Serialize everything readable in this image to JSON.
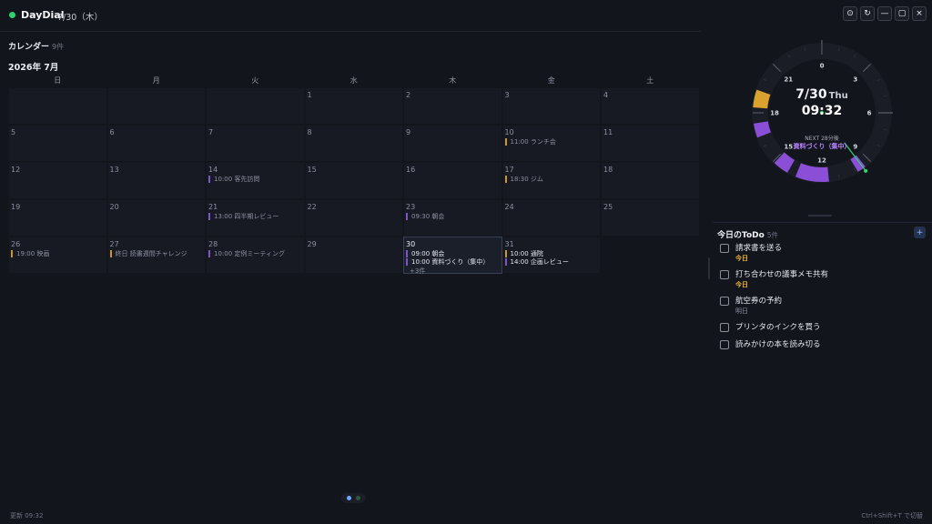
{
  "app": {
    "name": "DayDial",
    "date": "7/30（木）"
  },
  "window_buttons": [
    "⊙",
    "↻",
    "—",
    "▢",
    "×"
  ],
  "calendar": {
    "section_label": "カレンダー",
    "count": "9件",
    "month_title": "2026年 7月",
    "weekdays": [
      "日",
      "月",
      "火",
      "水",
      "木",
      "金",
      "土"
    ],
    "weeks": [
      [
        {
          "day": ""
        },
        {
          "day": ""
        },
        {
          "day": ""
        },
        {
          "day": "1"
        },
        {
          "day": "2"
        },
        {
          "day": "3"
        },
        {
          "day": "4"
        }
      ],
      [
        {
          "day": "5"
        },
        {
          "day": "6"
        },
        {
          "day": "7"
        },
        {
          "day": "8"
        },
        {
          "day": "9"
        },
        {
          "day": "10",
          "events": [
            {
              "text": "11:00 ランチ会",
              "color": "gold"
            }
          ]
        },
        {
          "day": "11"
        }
      ],
      [
        {
          "day": "12"
        },
        {
          "day": "13"
        },
        {
          "day": "14",
          "events": [
            {
              "text": "10:00 客先訪問",
              "color": "purple"
            }
          ]
        },
        {
          "day": "15"
        },
        {
          "day": "16"
        },
        {
          "day": "17",
          "events": [
            {
              "text": "18:30 ジム",
              "color": "gold"
            }
          ]
        },
        {
          "day": "18"
        }
      ],
      [
        {
          "day": "19"
        },
        {
          "day": "20"
        },
        {
          "day": "21",
          "events": [
            {
              "text": "13:00 四半期レビュー",
              "color": "purple"
            }
          ]
        },
        {
          "day": "22"
        },
        {
          "day": "23",
          "events": [
            {
              "text": "09:30 朝会",
              "color": "purple"
            }
          ]
        },
        {
          "day": "24"
        },
        {
          "day": "25"
        }
      ],
      [
        {
          "day": "26",
          "events": [
            {
              "text": "19:00 映画",
              "color": "gold"
            }
          ]
        },
        {
          "day": "27",
          "events": [
            {
              "text": "終日 読書週間チャレンジ",
              "color": "gold"
            }
          ]
        },
        {
          "day": "28",
          "events": [
            {
              "text": "10:00 定例ミーティング",
              "color": "purple"
            }
          ]
        },
        {
          "day": "29"
        },
        {
          "day": "30",
          "today": true,
          "events": [
            {
              "text": "09:00 朝会",
              "color": "purple"
            },
            {
              "text": "10:00 資料づくり（集中）",
              "color": "purple"
            }
          ],
          "more": "+3件"
        },
        {
          "day": "31",
          "bright": true,
          "events": [
            {
              "text": "10:00 通院",
              "color": "gold"
            },
            {
              "text": "14:00 企画レビュー",
              "color": "purple"
            }
          ]
        },
        {
          "day": "",
          "empty": true
        }
      ]
    ]
  },
  "clock": {
    "date": "7/30",
    "weekday": "Thu",
    "time": "09:32",
    "hour_labels": [
      "0",
      "3",
      "6",
      "9",
      "12",
      "15",
      "18",
      "21"
    ],
    "next_label": "NEXT 28分後",
    "next_title": "資料づくり（集中）",
    "colors": {
      "purple": "#8a4fd6",
      "gold": "#d9a22e",
      "hand": "#2fd36b"
    }
  },
  "todo": {
    "title": "今日のToDo",
    "count": "5件",
    "add_label": "+",
    "items": [
      {
        "title": "請求書を送る",
        "due": "今日",
        "due_type": "today"
      },
      {
        "title": "打ち合わせの議事メモ共有",
        "due": "今日",
        "due_type": "today"
      },
      {
        "title": "航空券の予約",
        "due": "明日",
        "due_type": "tomorrow"
      },
      {
        "title": "プリンタのインクを買う",
        "due": "",
        "due_type": ""
      },
      {
        "title": "読みかけの本を読み切る",
        "due": "",
        "due_type": ""
      }
    ]
  },
  "footer": {
    "updated": "更新 09:32",
    "shortcut": "Ctrl+Shift+T で切替"
  }
}
